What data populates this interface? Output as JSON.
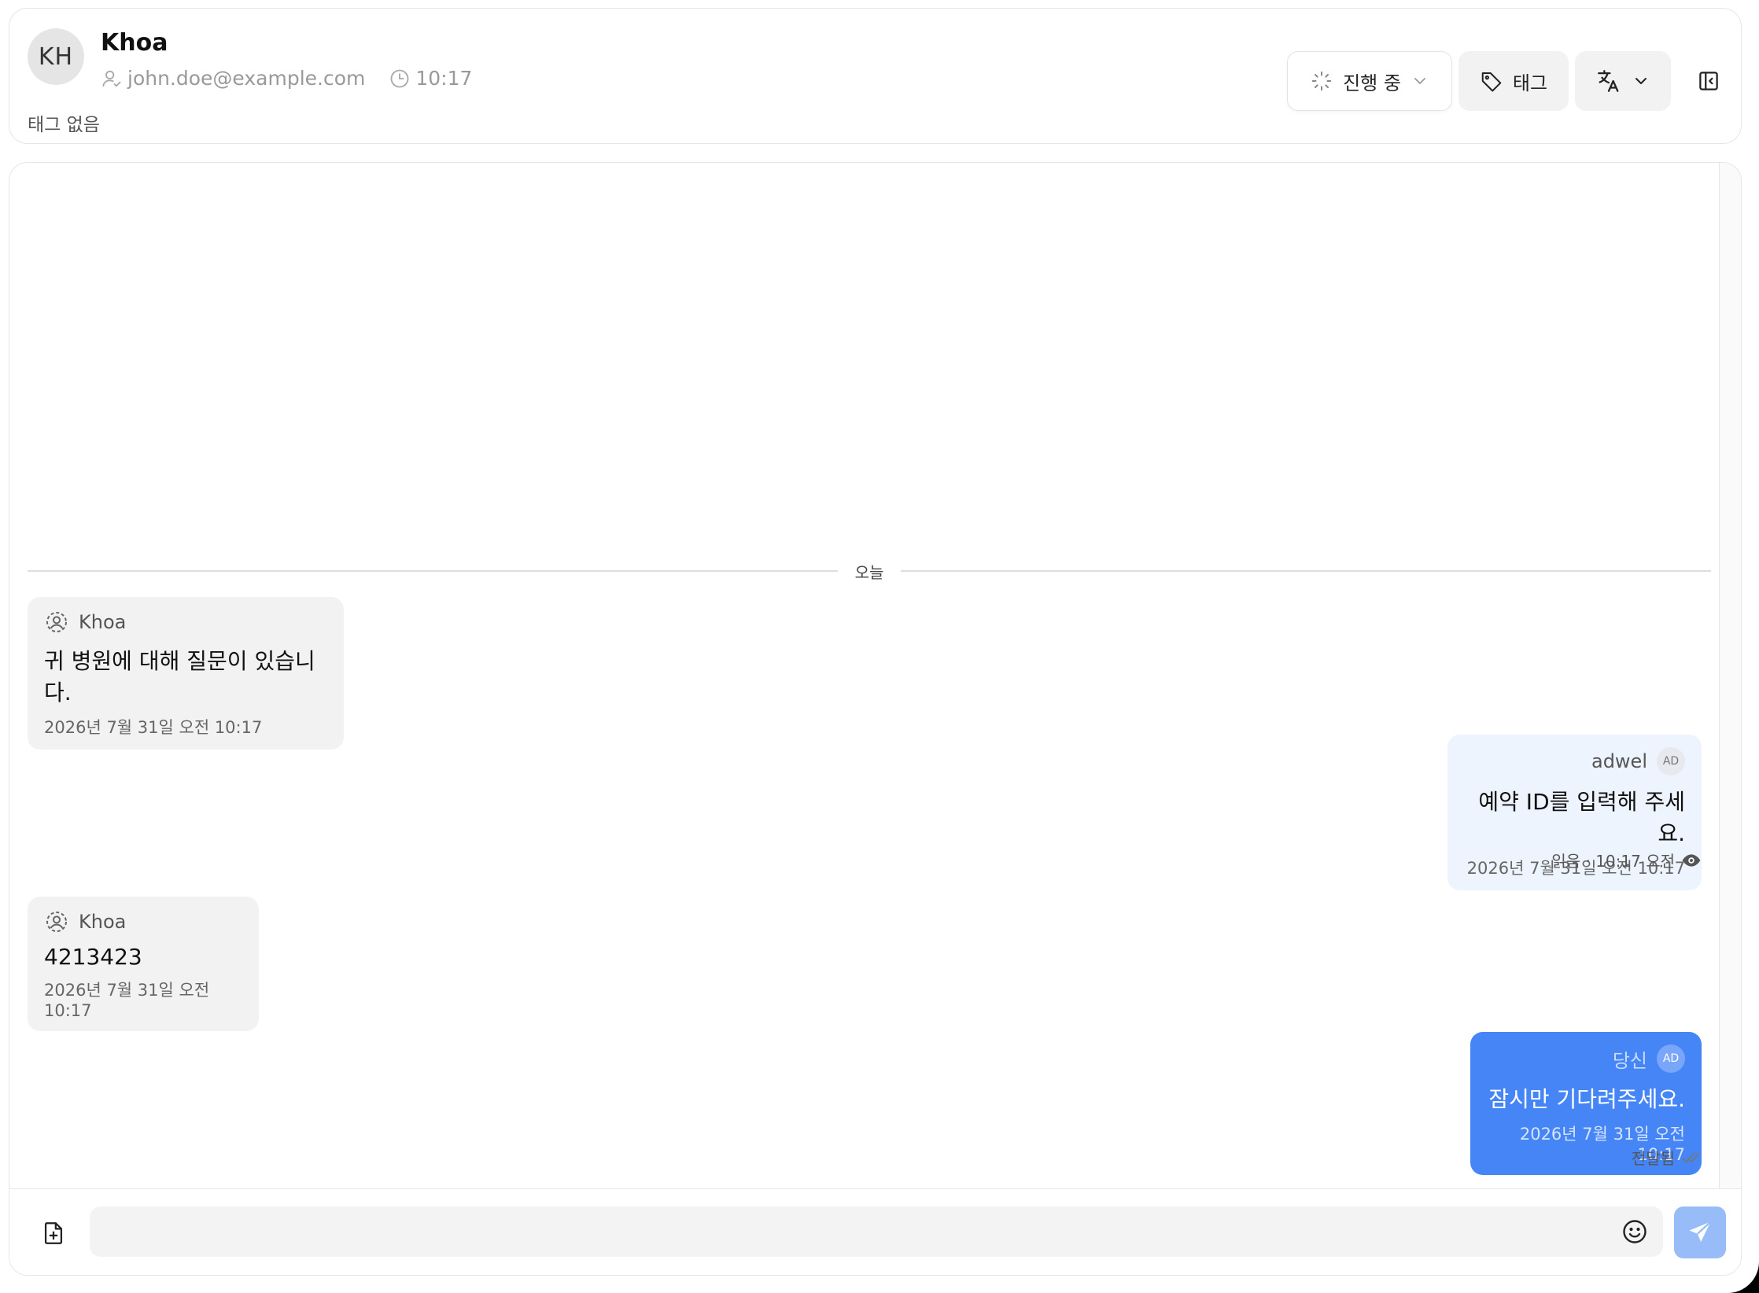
{
  "contact": {
    "initials": "KH",
    "name": "Khoa",
    "email": "john.doe@example.com",
    "time": "10:17",
    "no_tags": "태그 없음"
  },
  "toolbar": {
    "status_label": "진행 중",
    "tag_label": "태그"
  },
  "divider": {
    "label": "오늘"
  },
  "messages": [
    {
      "sender": "Khoa",
      "text": "귀 병원에 대해 질문이 있습니다.",
      "time": "2026년 7월 31일 오전 10:17"
    },
    {
      "sender": "adwel",
      "badge": "AD",
      "text": "예약 ID를 입력해 주세요.",
      "time": "2026년 7월 31일 오전 10:17",
      "status": "읽음 · 10:17 오전"
    },
    {
      "sender": "Khoa",
      "text": "4213423",
      "time": "2026년 7월 31일 오전 10:17"
    },
    {
      "sender": "당신",
      "badge": "AD",
      "text": "잠시만 기다려주세요.",
      "time": "2026년 7월 31일 오전 10:17",
      "status": "전달됨"
    }
  ],
  "composer": {
    "placeholder": ""
  },
  "colors": {
    "accent": "#4585f6",
    "send_button": "#97bcf8",
    "incoming_bubble": "#f2f2f2",
    "read_bubble": "#edf4fe"
  },
  "icons": {
    "user_check": "user-check-icon",
    "clock": "clock-icon",
    "loader": "loader-icon",
    "tag": "tag-icon",
    "translate": "translate-icon",
    "panel": "panel-left-icon",
    "attach": "file-plus-icon",
    "emoji": "smile-icon",
    "send": "send-icon",
    "eye": "eye-icon",
    "double_check": "double-check-icon"
  }
}
